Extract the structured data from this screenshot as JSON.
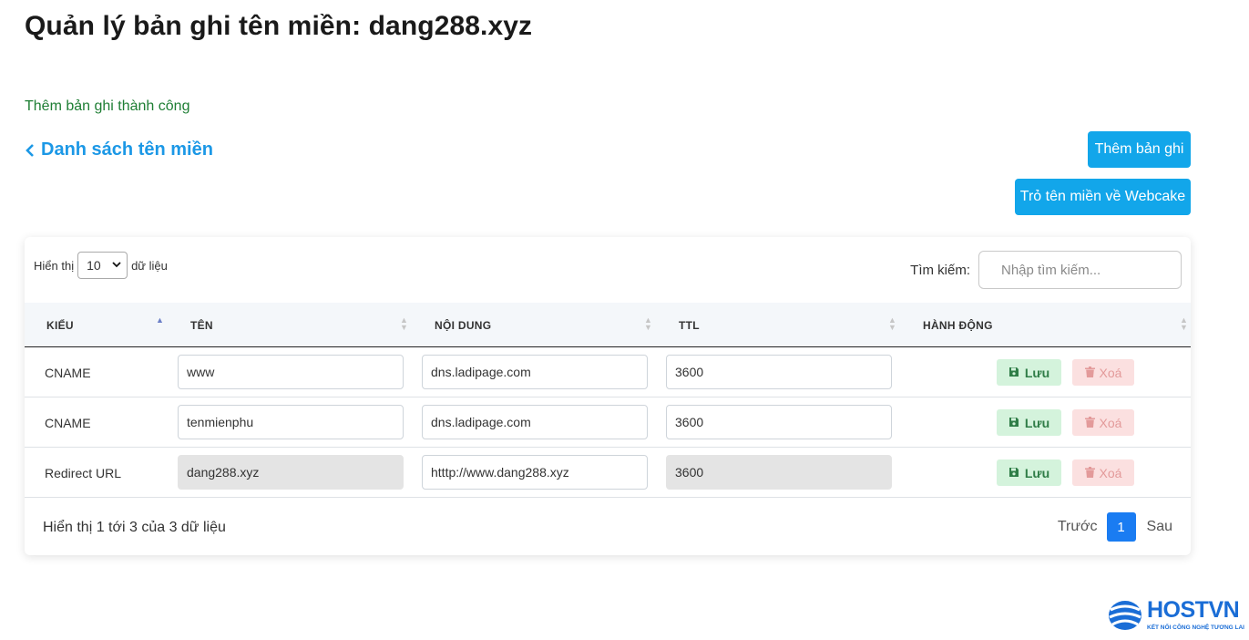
{
  "page_title": "Quản lý bản ghi tên miền: dang288.xyz",
  "success_message": "Thêm bản ghi thành công",
  "back_link": "Danh sách tên miền",
  "buttons": {
    "add_record": "Thêm bản ghi",
    "point_webcake": "Trỏ tên miền về Webcake"
  },
  "table_controls": {
    "show_prefix": "Hiển thị",
    "show_value": "10",
    "show_suffix": "dữ liệu",
    "search_label": "Tìm kiếm:",
    "search_placeholder": "Nhập tìm kiếm..."
  },
  "columns": [
    "KIỂU",
    "TÊN",
    "NỘI DUNG",
    "TTL",
    "HÀNH ĐỘNG"
  ],
  "rows": [
    {
      "type": "CNAME",
      "name": "www",
      "content": "dns.ladipage.com",
      "ttl": "3600",
      "name_disabled": false,
      "ttl_disabled": false
    },
    {
      "type": "CNAME",
      "name": "tenmienphu",
      "content": "dns.ladipage.com",
      "ttl": "3600",
      "name_disabled": false,
      "ttl_disabled": false
    },
    {
      "type": "Redirect URL",
      "name": "dang288.xyz",
      "content": "htttp://www.dang288.xyz",
      "ttl": "3600",
      "name_disabled": true,
      "ttl_disabled": true
    }
  ],
  "row_actions": {
    "save": "Lưu",
    "delete": "Xoá"
  },
  "footer": {
    "info": "Hiển thị 1 tới 3 của 3 dữ liệu",
    "prev": "Trước",
    "current_page": "1",
    "next": "Sau"
  },
  "logo": {
    "brand": "HOSTVN",
    "tagline": "KẾT NỐI CÔNG NGHỆ TƯƠNG LAI"
  },
  "colors": {
    "accent": "#12a6ea",
    "link": "#1c98e6",
    "success_text": "#1e7e34",
    "page_active": "#1a7cf2"
  }
}
